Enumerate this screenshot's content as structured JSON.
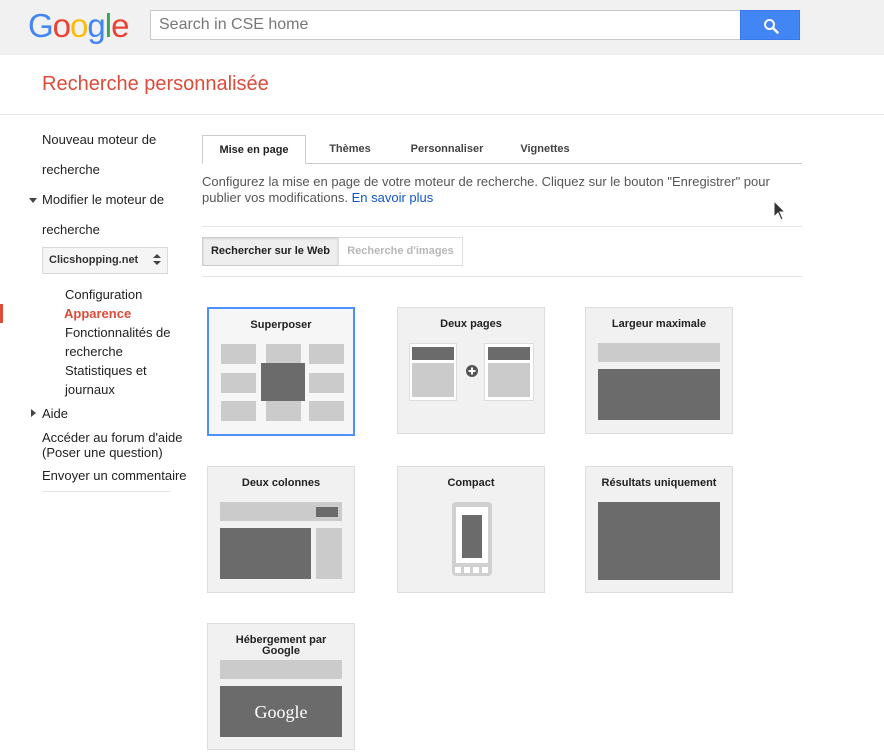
{
  "header": {
    "logo_letters": [
      "G",
      "o",
      "o",
      "g",
      "l",
      "e"
    ],
    "search_placeholder": "Search in CSE home",
    "search_button": "search-icon"
  },
  "page": {
    "title": "Recherche personnalisée"
  },
  "sidebar": {
    "new_engine_line1": "Nouveau moteur de",
    "new_engine_line2": "recherche",
    "edit_engine_line1": "Modifier le moteur de",
    "edit_engine_line2": "recherche",
    "engine_selected": "Clicshopping.net",
    "sub_items": [
      "Configuration",
      "Apparence",
      "Fonctionnalités de",
      "recherche",
      "Statistiques et",
      "journaux"
    ],
    "help": "Aide",
    "forum_line1": "Accéder au forum d'aide",
    "forum_line2": "(Poser une question)",
    "feedback": "Envoyer un commentaire"
  },
  "tabs": [
    "Mise en page",
    "Thèmes",
    "Personnaliser",
    "Vignettes"
  ],
  "description": {
    "text": "Configurez la mise en page de votre moteur de recherche. Cliquez sur le bouton \"Enregistrer\" pour publier vos modifications.",
    "link": "En savoir plus"
  },
  "segments": {
    "web": "Rechercher sur le Web",
    "images": "Recherche d'images"
  },
  "layouts": [
    {
      "title": "Superposer",
      "selected": true
    },
    {
      "title": "Deux pages",
      "selected": false
    },
    {
      "title": "Largeur maximale",
      "selected": false
    },
    {
      "title": "Deux colonnes",
      "selected": false
    },
    {
      "title": "Compact",
      "selected": false
    },
    {
      "title": "Résultats uniquement",
      "selected": false
    },
    {
      "title_line1": "Hébergement par",
      "title_line2": "Google",
      "thumb_text": "Google",
      "selected": false
    }
  ],
  "colors": {
    "accent": "#dd4b39",
    "link": "#1155cc",
    "search_blue": "#4285f4",
    "selected_border": "#4d90fe"
  }
}
